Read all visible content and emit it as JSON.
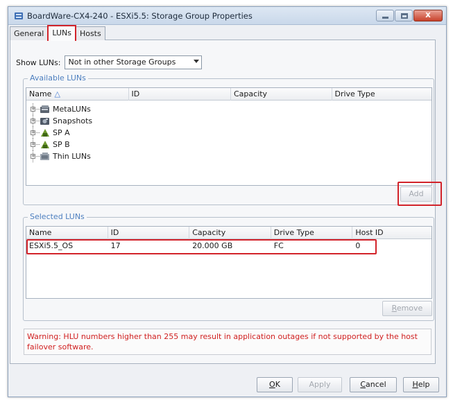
{
  "window": {
    "title": "BoardWare-CX4-240 - ESXi5.5: Storage Group Properties",
    "close_glyph": "x"
  },
  "tabs": [
    {
      "label": "General",
      "active": false
    },
    {
      "label": "LUNs",
      "active": true
    },
    {
      "label": "Hosts",
      "active": false
    }
  ],
  "show_luns": {
    "label": "Show LUNs:",
    "selected": "Not in other Storage Groups"
  },
  "available_luns": {
    "legend": "Available LUNs",
    "columns": [
      "Name",
      "ID",
      "Capacity",
      "Drive Type"
    ],
    "sort_icon": "triangle-up-icon",
    "tree": [
      {
        "label": "MetaLUNs",
        "icon": "metalun-icon"
      },
      {
        "label": "Snapshots",
        "icon": "snapshot-icon"
      },
      {
        "label": "SP A",
        "icon": "storage-processor-icon"
      },
      {
        "label": "SP B",
        "icon": "storage-processor-icon"
      },
      {
        "label": "Thin LUNs",
        "icon": "thin-lun-icon"
      }
    ],
    "add_label": "Add"
  },
  "selected_luns": {
    "legend": "Selected LUNs",
    "columns": [
      "Name",
      "ID",
      "Capacity",
      "Drive Type",
      "Host ID"
    ],
    "rows": [
      {
        "name": "ESXi5.5_OS",
        "id": "17",
        "capacity": "20.000 GB",
        "drive_type": "FC",
        "host_id": "0"
      }
    ],
    "remove_label_prefix": "",
    "remove_label_mnemonic": "R",
    "remove_label_rest": "emove"
  },
  "warning": "Warning: HLU numbers higher than 255 may result in application outages if not supported by the host failover software.",
  "buttons": {
    "ok_mnemonic": "O",
    "ok_rest": "K",
    "apply": "Apply",
    "cancel_mnemonic": "C",
    "cancel_rest": "ancel",
    "help_mnemonic": "H",
    "help_rest": "elp"
  },
  "colors": {
    "highlight_red": "#d2232a",
    "legend_blue": "#4d7fbf",
    "warning_red": "#d02020"
  }
}
